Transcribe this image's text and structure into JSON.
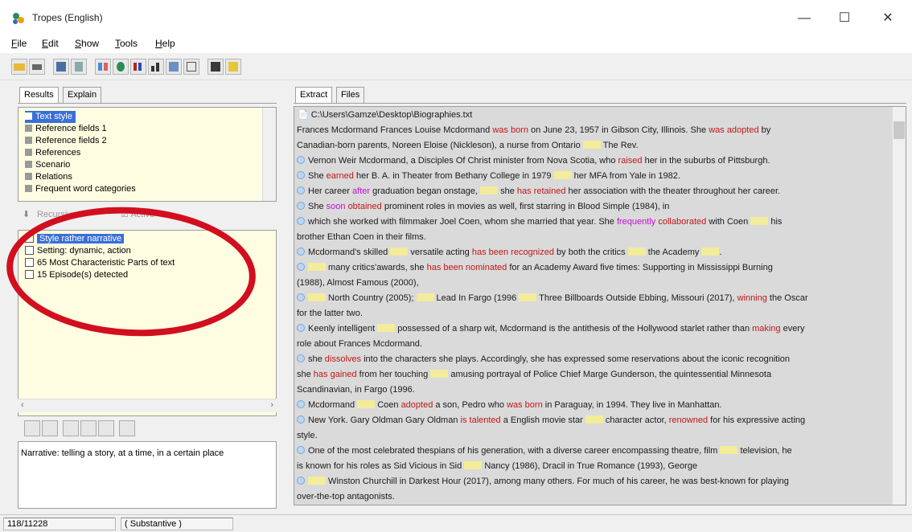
{
  "window": {
    "title": "Tropes (English)",
    "controls": {
      "minimize": "—",
      "maximize": "☐",
      "close": "✕"
    }
  },
  "menu": [
    {
      "label": "File",
      "accel": "F",
      "rest": "ile"
    },
    {
      "label": "Edit",
      "accel": "E",
      "rest": "dit"
    },
    {
      "label": "Show",
      "accel": "S",
      "rest": "how"
    },
    {
      "label": "Tools",
      "accel": "T",
      "rest": "ools"
    },
    {
      "label": "Help",
      "accel": "H",
      "rest": "elp"
    }
  ],
  "left_panel": {
    "tabs": [
      "Results",
      "Explain"
    ],
    "categories": [
      "Text style",
      "Reference fields 1",
      "Reference fields 2",
      "References",
      "Scenario",
      "Relations",
      "Frequent word categories"
    ],
    "selected_category": "Text style",
    "mid_buttons": {
      "left": "Recursive",
      "right": "Active"
    },
    "results": [
      "Style rather narrative",
      "Setting: dynamic, action",
      "65 Most Characteristic Parts of text",
      "15 Episode(s) detected"
    ],
    "selected_result": "Style rather narrative",
    "description": "Narrative: telling a story, at a time, in a certain place"
  },
  "right_panel": {
    "tabs": [
      "Extract",
      "Files"
    ],
    "file_path": "C:\\Users\\Gamze\\Desktop\\Biographies.txt",
    "lines": [
      {
        "t": "Frances Mcdormand Frances Louise Mcdormand was born on June 23, 1957 in Gibson City, Illinois. She was adopted by"
      },
      {
        "t": "Canadian-born parents, Noreen Eloise (Nickleson), a nurse from Ontario ___ The Rev."
      },
      {
        "t": "Vernon Weir Mcdormand, a Disciples Of Christ minister from Nova Scotia, who raised her in the suburbs of Pittsburgh.",
        "b": true
      },
      {
        "t": "She earned her B. A. in Theater from Bethany College in 1979 ___ her MFA from Yale in 1982.",
        "b": true
      },
      {
        "t": "Her career after graduation began onstage, ___ she has retained her association with the theater throughout her career.",
        "b": true
      },
      {
        "t": "She soon obtained prominent roles in movies as well, first starring in Blood Simple (1984), in",
        "b": true
      },
      {
        "t": "which she worked with filmmaker Joel Coen,  whom she married that year. She frequently collaborated with Coen ___ his",
        "b": true
      },
      {
        "t": "brother Ethan Coen in their films."
      },
      {
        "t": "Mcdormand's skilled ___ versatile acting has been recognized by both the critics ___ the Academy ___.",
        "b": true
      },
      {
        "t": "___ many critics'awards, she has been nominated for an Academy Award five times: Supporting in Mississippi Burning",
        "b": true
      },
      {
        "t": "(1988), Almost Famous (2000),"
      },
      {
        "t": "___ North Country (2005); ___ Lead In Fargo (1996 ___ Three Billboards Outside Ebbing, Missouri (2017), winning the Oscar",
        "b": true
      },
      {
        "t": "for the latter two."
      },
      {
        "t": "Keenly intelligent ___ possessed of a sharp wit, Mcdormand is the antithesis of the Hollywood starlet rather than making every",
        "b": true
      },
      {
        "t": "role about Frances Mcdormand."
      },
      {
        "t": "she dissolves into the characters she plays. Accordingly, she has expressed some reservations about the iconic recognition",
        "b": true
      },
      {
        "t": "she has gained from her touching ___ amusing portrayal of Police Chief Marge Gunderson, the quintessential Minnesota"
      },
      {
        "t": "Scandinavian, in Fargo (1996."
      },
      {
        "t": "Mcdormand ___ Coen adopted a son, Pedro who was born in Paraguay, in 1994. They live in Manhattan.",
        "b": true
      },
      {
        "t": "New York. Gary Oldman Gary Oldman is talented a English movie star ___ character actor, renowned for his expressive acting",
        "b": true
      },
      {
        "t": "style."
      },
      {
        "t": "One of the most celebrated thespians of his generation, with a diverse career encompassing theatre, film ___ television, he",
        "b": true
      },
      {
        "t": "is known for his roles as Sid Vicious in Sid ___ Nancy (1986), Dracil in True Romance (1993), George"
      },
      {
        "t": "___ Winston Churchill in Darkest Hour (2017), among many others. For much of his career, he was best-known for playing",
        "b": true
      },
      {
        "t": "over-the-top antagonists."
      }
    ]
  },
  "status": {
    "position": "118/11228",
    "mode": "( Substantive )"
  },
  "colors": {
    "selection": "#3a6fd8",
    "list_bg": "#fffde1",
    "verb": "#c01818",
    "modality": "#c010d0",
    "highlight": "#f3ec9a",
    "annotation": "#d10f1f"
  }
}
